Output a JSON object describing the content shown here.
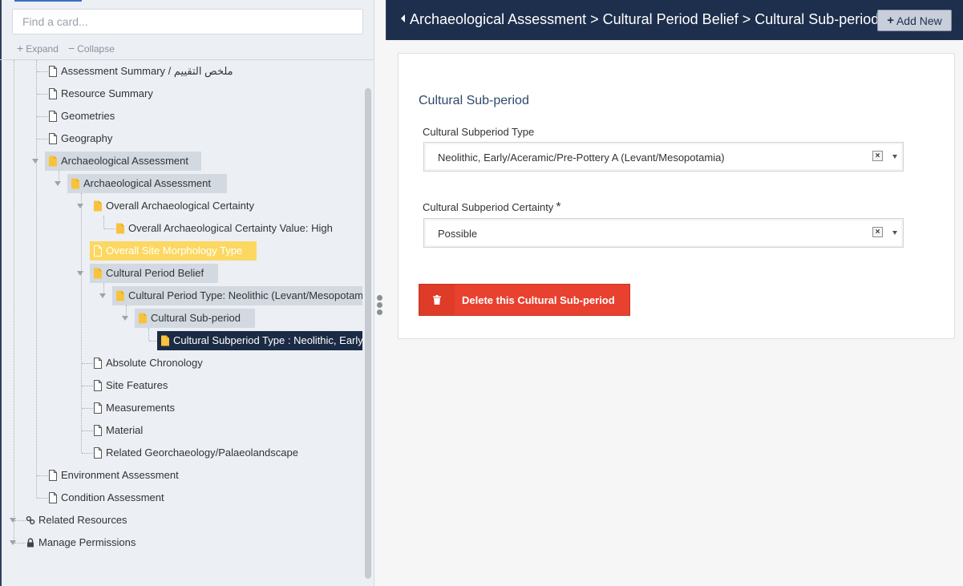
{
  "search": {
    "placeholder": "Find a card..."
  },
  "tools": {
    "expand": "Expand",
    "collapse": "Collapse",
    "expand_sym": "+",
    "collapse_sym": "−"
  },
  "tree": [
    {
      "label": "Assessment Summary / ملخص التقييم",
      "icon": "page-icon"
    },
    {
      "label": "Resource Summary",
      "icon": "page-icon"
    },
    {
      "label": "Geometries",
      "icon": "page-icon"
    },
    {
      "label": "Geography",
      "icon": "page-icon"
    },
    {
      "label": "Archaeological Assessment",
      "icon": "folder-icon"
    },
    {
      "label": "Archaeological Assessment",
      "icon": "folder-icon"
    },
    {
      "label": "Overall Archaeological Certainty",
      "icon": "folder-icon"
    },
    {
      "label": "Overall Archaeological Certainty Value: High",
      "icon": "folder-icon"
    },
    {
      "label": "Overall Site Morphology Type",
      "icon": "page-icon"
    },
    {
      "label": "Cultural Period Belief",
      "icon": "folder-icon"
    },
    {
      "label": "Cultural Period Type: Neolithic (Levant/Mesopotamia)",
      "icon": "folder-icon"
    },
    {
      "label": "Cultural Sub-period",
      "icon": "folder-icon"
    },
    {
      "label": "Cultural Subperiod Type : Neolithic, Early/Aceramic/Pre-Pottery A",
      "icon": "folder-icon"
    },
    {
      "label": "Absolute Chronology",
      "icon": "page-icon"
    },
    {
      "label": "Site Features",
      "icon": "page-icon"
    },
    {
      "label": "Measurements",
      "icon": "page-icon"
    },
    {
      "label": "Material",
      "icon": "page-icon"
    },
    {
      "label": "Related Georchaeology/Palaeolandscape",
      "icon": "page-icon"
    },
    {
      "label": "Environment Assessment",
      "icon": "page-icon"
    },
    {
      "label": "Condition Assessment",
      "icon": "page-icon"
    },
    {
      "label": "Related Resources",
      "icon": "link-icon"
    },
    {
      "label": "Manage Permissions",
      "icon": "lock-icon"
    }
  ],
  "header": {
    "breadcrumb": "Archaeological Assessment > Cultural Period Belief > Cultural Sub-period",
    "add_new": "Add New"
  },
  "card": {
    "title": "Cultural Sub-period",
    "fields": [
      {
        "label": "Cultural Subperiod Type",
        "value": "Neolithic, Early/Aceramic/Pre-Pottery A (Levant/Mesopotamia)",
        "required": false
      },
      {
        "label": "Cultural Subperiod Certainty",
        "value": "Possible",
        "required": true,
        "required_mark": "*"
      }
    ],
    "delete_label": "Delete this Cultural Sub-period"
  },
  "colors": {
    "header_bg": "#1e2f4d",
    "selected_node_bg": "#1c2b45",
    "highlight_node_bg": "#fcd862",
    "delete_button_bg": "#e8412f",
    "folder_icon": "#f9c23c"
  }
}
